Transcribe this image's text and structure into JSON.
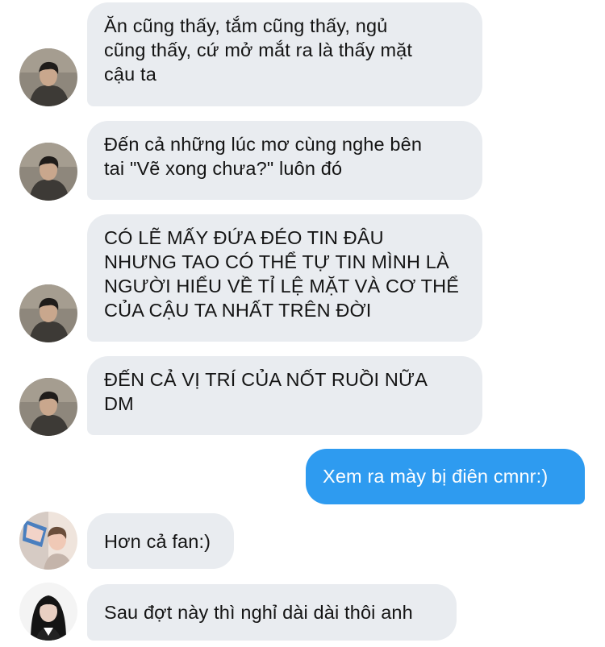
{
  "messages": [
    {
      "sender": "friend-a",
      "lines": [
        "Ăn cũng thấy, tắm cũng thấy, ngủ",
        "cũng thấy, cứ mở mắt ra là thấy mặt",
        "cậu ta"
      ]
    },
    {
      "sender": "friend-a",
      "lines": [
        "Đến cả những lúc mơ cùng nghe bên",
        "tai \"Vẽ xong chưa?\" luôn đó"
      ]
    },
    {
      "sender": "friend-a",
      "lines": [
        "CÓ LẼ MẤY ĐỨA ĐÉO TIN ĐÂU",
        "NHƯNG TAO CÓ THỂ TỰ TIN MÌNH LÀ",
        "NGƯỜI HIỂU VỀ TỈ LỆ MẶT VÀ CƠ THỂ",
        "CỦA CẬU TA NHẤT TRÊN ĐỜI"
      ]
    },
    {
      "sender": "friend-a",
      "lines": [
        "ĐẾN CẢ VỊ TRÍ CỦA NỐT RUỒI NỮA",
        "DM"
      ]
    },
    {
      "sender": "me",
      "lines": [
        "Xem ra mày bị điên cmnr:)"
      ]
    },
    {
      "sender": "friend-b",
      "lines": [
        "Hơn cả fan:)"
      ]
    },
    {
      "sender": "friend-c",
      "lines": [
        "Sau đợt này thì nghỉ dài dài thôi anh"
      ]
    }
  ],
  "colors": {
    "incoming_bubble": "#e9ecf0",
    "outgoing_bubble": "#2e9bf0",
    "incoming_text": "#141414",
    "outgoing_text": "#ffffff"
  },
  "icons": {
    "friend-a": "avatar-friend-a-icon",
    "friend-b": "avatar-friend-b-icon",
    "friend-c": "avatar-friend-c-icon"
  }
}
